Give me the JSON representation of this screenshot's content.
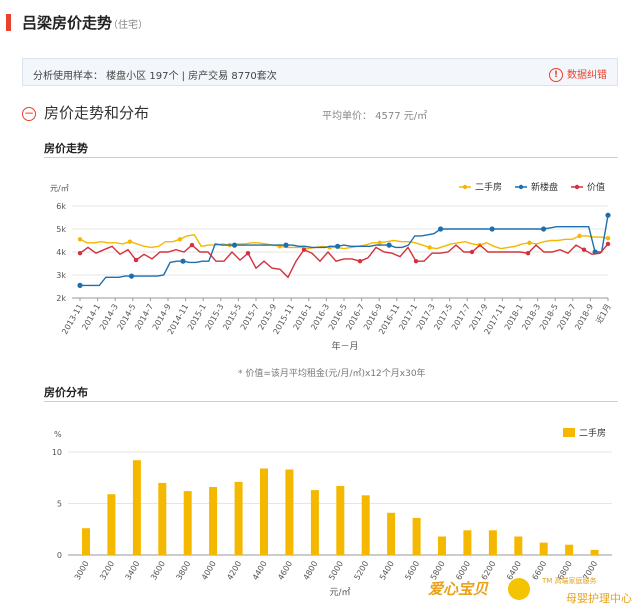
{
  "header": {
    "title": "吕梁房价走势",
    "subtitle": "（住宅）"
  },
  "sample": {
    "text": "分析使用样本： 楼盘小区 197个   |   房产交易 8770套次",
    "report_icon": "!",
    "report_label": "数据纠错"
  },
  "section": {
    "icon": "minus",
    "title": "房价走势和分布",
    "avg": "平均单价： 4577 元/㎡"
  },
  "trend_heading": "房价走势",
  "dist_heading": "房价分布",
  "note": "* 价值=该月平均租金(元/月/㎡)x12个月x30年",
  "watermark": {
    "brand": "爱心宝贝",
    "tm": "TM 高端家庭服务",
    "tag": "母婴护理中心"
  },
  "colors": {
    "secondhand": "#f5b800",
    "newhouse": "#1f6fad",
    "value": "#d4303e",
    "bar": "#f5b800"
  },
  "chart_data": [
    {
      "type": "line",
      "ylabel": "元/㎡",
      "xlabel": "年－月",
      "ylim": [
        2000,
        6000
      ],
      "yticks": [
        "2k",
        "3k",
        "4k",
        "5k",
        "6k"
      ],
      "legend_position": "top-right",
      "x_ticklabels": [
        "2013-11",
        "2014-1",
        "2014-3",
        "2014-5",
        "2014-7",
        "2014-9",
        "2014-11",
        "2015-1",
        "2015-3",
        "2015-5",
        "2015-7",
        "2015-9",
        "2015-11",
        "2016-1",
        "2016-3",
        "2016-5",
        "2016-7",
        "2016-9",
        "2016-11",
        "2017-1",
        "2017-3",
        "2017-5",
        "2017-7",
        "2017-9",
        "2017-11",
        "2018-1",
        "2018-3",
        "2018-5",
        "2018-7",
        "2018-9",
        "近1月"
      ],
      "series": [
        {
          "name": "二手房",
          "values": [
            4550,
            4400,
            4400,
            4450,
            4400,
            4400,
            4350,
            4450,
            4350,
            4250,
            4200,
            4250,
            4450,
            4450,
            4550,
            4700,
            4750,
            4250,
            4300,
            4300,
            4350,
            4300,
            4350,
            4350,
            4400,
            4400,
            4350,
            4300,
            4250,
            4200,
            4200,
            4200,
            4150,
            4200,
            4250,
            4200,
            4200,
            4150,
            4200,
            4250,
            4300,
            4400,
            4400,
            4450,
            4500,
            4450,
            4450,
            4400,
            4300,
            4200,
            4150,
            4250,
            4350,
            4400,
            4450,
            4350,
            4300,
            4400,
            4250,
            4150,
            4200,
            4250,
            4350,
            4400,
            4350,
            4450,
            4500,
            4500,
            4550,
            4550,
            4700,
            4700,
            4650,
            4650,
            4600
          ]
        },
        {
          "name": "新楼盘",
          "values": [
            2550,
            2550,
            2550,
            2550,
            2900,
            2900,
            2900,
            2950,
            2950,
            2950,
            2950,
            2950,
            2950,
            3000,
            3550,
            3600,
            3600,
            3550,
            3550,
            3600,
            3600,
            4350,
            4300,
            4300,
            4300,
            4300,
            4300,
            4300,
            4300,
            4300,
            4300,
            4300,
            4300,
            4300,
            4250,
            4250,
            4200,
            4200,
            4200,
            4250,
            4250,
            4300,
            4250,
            4250,
            4250,
            4250,
            4300,
            4300,
            4300,
            4200,
            4200,
            4300,
            4700,
            4700,
            4750,
            4800,
            5000,
            5000,
            5000,
            5000,
            5000,
            5000,
            5000,
            5000,
            5000,
            5000,
            5000,
            5000,
            5000,
            5000,
            5000,
            5000,
            5000,
            5050,
            5100,
            5100,
            5100,
            5100,
            5100,
            5100,
            4000,
            4000,
            5600
          ]
        },
        {
          "name": "价值",
          "values": [
            3950,
            4200,
            3950,
            4100,
            4250,
            3900,
            4100,
            3650,
            3900,
            3700,
            4000,
            4000,
            4100,
            4000,
            4300,
            4000,
            4000,
            3600,
            3600,
            4000,
            3650,
            3950,
            3300,
            3600,
            3300,
            3250,
            2900,
            3600,
            4100,
            3950,
            3600,
            4000,
            3600,
            3700,
            3700,
            3600,
            3750,
            4200,
            4000,
            3950,
            3800,
            4200,
            3600,
            3600,
            3950,
            3950,
            4000,
            4300,
            4000,
            4000,
            4300,
            4000,
            4000,
            4000,
            4000,
            4000,
            3950,
            4300,
            4000,
            4000,
            4100,
            3950,
            4300,
            4100,
            3900,
            3950,
            4350
          ]
        }
      ]
    },
    {
      "type": "bar",
      "ylabel": "%",
      "xlabel": "元/㎡",
      "ylim": [
        0,
        10
      ],
      "yticks": [
        "0",
        "5",
        "10"
      ],
      "legend_position": "top-right",
      "categories": [
        "3000",
        "3200",
        "3400",
        "3600",
        "3800",
        "4000",
        "4200",
        "4400",
        "4600",
        "4800",
        "5000",
        "5200",
        "5400",
        "5600",
        "5800",
        "6000",
        "6200",
        "6400",
        "6600",
        "6800",
        "7000"
      ],
      "series": [
        {
          "name": "二手房",
          "values": [
            2.6,
            5.9,
            9.2,
            7.0,
            6.2,
            6.6,
            7.1,
            8.4,
            8.3,
            6.3,
            6.7,
            5.8,
            4.1,
            3.6,
            1.8,
            2.4,
            2.4,
            1.8,
            1.2,
            1.0,
            0.5
          ]
        }
      ]
    }
  ]
}
